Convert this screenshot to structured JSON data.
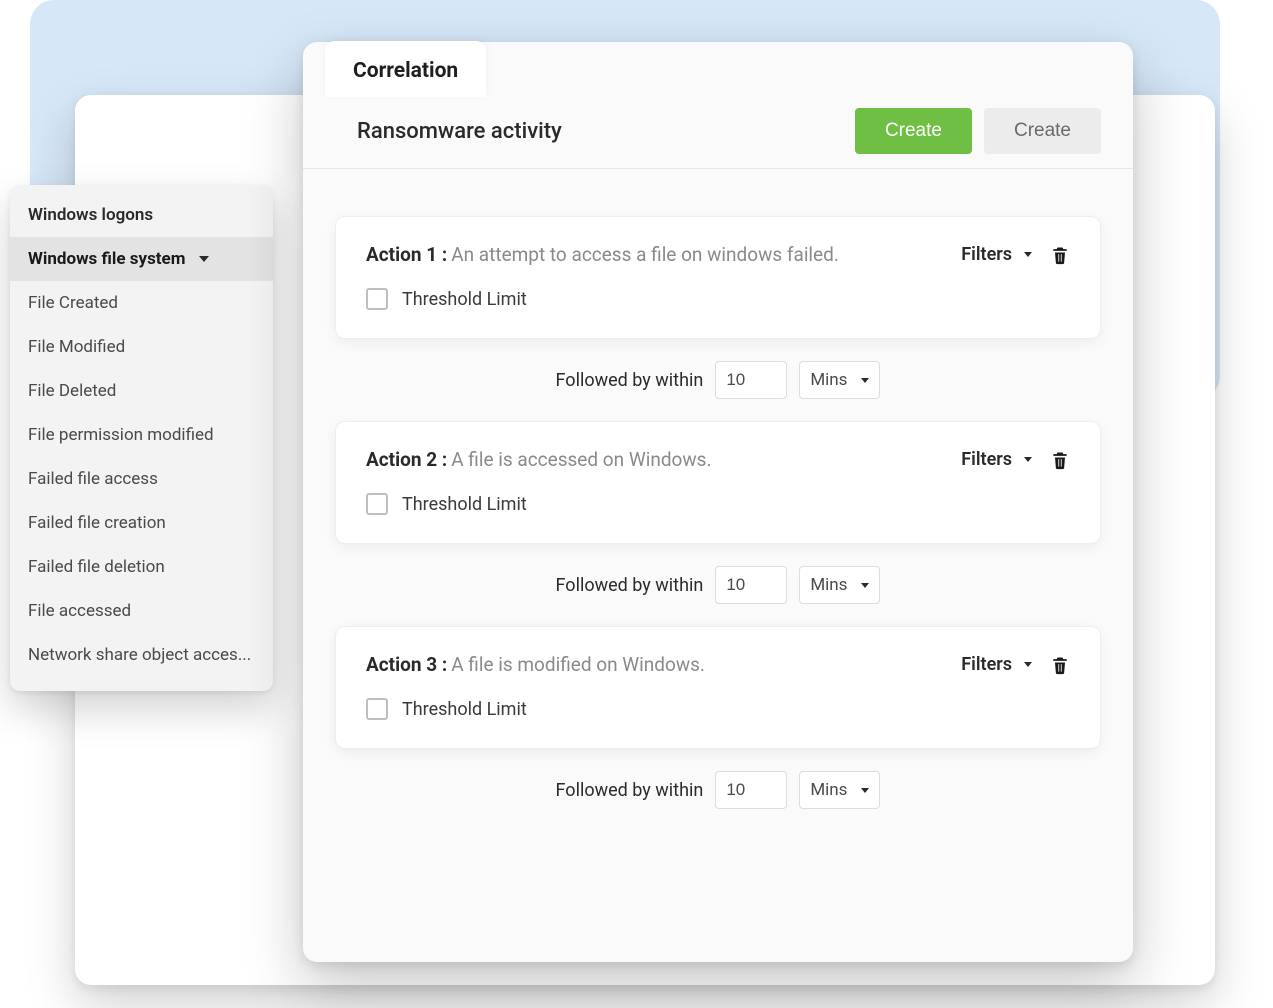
{
  "colors": {
    "accent": "#6fbf44",
    "muted": "#8a8a8a"
  },
  "tab": {
    "label": "Correlation"
  },
  "header": {
    "title": "Ransomware activity",
    "primary_btn": "Create",
    "secondary_btn": "Create"
  },
  "sidebar": {
    "items": [
      {
        "label": "Windows logons",
        "selected": false,
        "head": true
      },
      {
        "label": "Windows file system",
        "selected": true,
        "has_caret": true
      },
      {
        "label": "File Created"
      },
      {
        "label": "File Modified"
      },
      {
        "label": "File Deleted"
      },
      {
        "label": "File permission modified"
      },
      {
        "label": "Failed file access"
      },
      {
        "label": "Failed file creation"
      },
      {
        "label": "Failed file deletion"
      },
      {
        "label": "File accessed"
      },
      {
        "label": "Network share object acces..."
      }
    ]
  },
  "common": {
    "filters_label": "Filters",
    "threshold_label": "Threshold Limit",
    "followed_label": "Followed by within",
    "unit_label": "Mins"
  },
  "actions": [
    {
      "title": "Action 1 :",
      "desc": "An attempt to access a file on windows failed.",
      "threshold_checked": false,
      "followed_value": "10"
    },
    {
      "title": "Action 2 :",
      "desc": "A file is accessed on Windows.",
      "threshold_checked": false,
      "followed_value": "10"
    },
    {
      "title": "Action 3 :",
      "desc": "A file is modified on Windows.",
      "threshold_checked": false,
      "followed_value": "10"
    }
  ]
}
